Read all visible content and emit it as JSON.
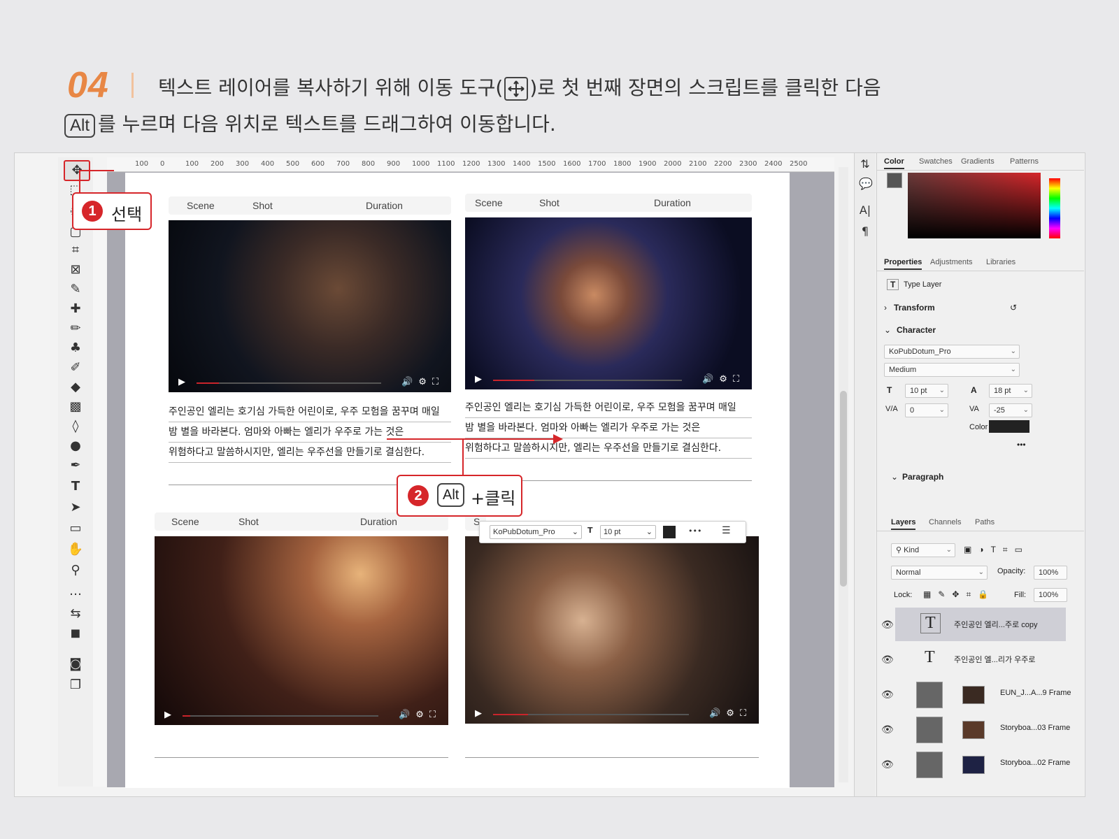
{
  "step": {
    "number": "04"
  },
  "instruction": {
    "line1_before": "텍스트 레이어를 복사하기 위해 이동 도구(",
    "line1_after": ")로 첫 번째 장면의 스크립트를 클릭한 다음",
    "key": "Alt",
    "line2": "를 누르며 다음 위치로 텍스트를 드래그하여 이동합니다."
  },
  "callouts": {
    "one": {
      "badge": "1",
      "text": "선택"
    },
    "two": {
      "badge": "2",
      "key": "Alt",
      "text": "+클릭"
    }
  },
  "ruler": {
    "h_ticks": [
      "100",
      "0",
      "100",
      "200",
      "300",
      "400",
      "500",
      "600",
      "700",
      "800",
      "900",
      "1000",
      "1100",
      "1200",
      "1300",
      "1400",
      "1500",
      "1600",
      "1700",
      "1800",
      "1900",
      "2000",
      "2100",
      "2200",
      "2300",
      "2400",
      "2500"
    ]
  },
  "frames": [
    {
      "scene": "Scene",
      "shot": "Shot",
      "duration": "Duration",
      "lines": [
        "주인공인 엘리는 호기심 가득한 어린이로, 우주 모험을 꿈꾸며 매일",
        "밤 별을 바라본다. 엄마와 아빠는 엘리가 우주로 가는 것은",
        "위험하다고 말씀하시지만, 엘리는 우주선을 만들기로 결심한다."
      ]
    },
    {
      "scene": "Scene",
      "shot": "Shot",
      "duration": "Duration",
      "lines": [
        "주인공인 엘리는 호기심 가득한 어린이로, 우주 모험을 꿈꾸며 매일",
        "밤 별을 바라본다. 엄마와 아빠는 엘리가 우주로 가는 것은",
        "위험하다고 말씀하시지만, 엘리는 우주선을 만들기로 결심한다."
      ]
    },
    {
      "scene": "Scene",
      "shot": "Shot",
      "duration": "Duration",
      "lines": []
    },
    {
      "scene": "S",
      "shot": "",
      "duration": "",
      "lines": []
    }
  ],
  "minibar": {
    "font": "KoPubDotum_Pro",
    "size": "10 pt",
    "more": "•••"
  },
  "panel": {
    "color_tabs": [
      "Color",
      "Swatches",
      "Gradients",
      "Patterns"
    ],
    "prop_tabs": [
      "Properties",
      "Adjustments",
      "Libraries"
    ],
    "type_layer": "Type Layer",
    "transform": "Transform",
    "character": "Character",
    "font_family": "KoPubDotum_Pro",
    "font_style": "Medium",
    "font_size": "10 pt",
    "leading": "18 pt",
    "kerning": "0",
    "tracking": "-25",
    "color_label": "Color",
    "more": "•••",
    "paragraph": "Paragraph",
    "layer_tabs": [
      "Layers",
      "Channels",
      "Paths"
    ],
    "kind": "Kind",
    "blend": "Normal",
    "opacity_label": "Opacity:",
    "opacity": "100%",
    "lock_label": "Lock:",
    "fill_label": "Fill:",
    "fill": "100%",
    "layers": [
      {
        "name": "주인공인 엘리...주로 copy",
        "kind": "T"
      },
      {
        "name": "주인공인 엘...리가 우주로",
        "kind": "T"
      },
      {
        "name": "EUN_J...A...9 Frame",
        "kind": "frame"
      },
      {
        "name": "Storyboa...03 Frame",
        "kind": "frame"
      },
      {
        "name": "Storyboa...02 Frame",
        "kind": "frame"
      }
    ]
  },
  "colors": {
    "accent": "#d6262a",
    "step": "#e88745"
  }
}
